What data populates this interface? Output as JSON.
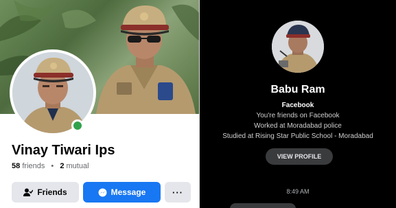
{
  "profile": {
    "name": "Vinay Tiwari Ips",
    "friends_count": "58",
    "friends_label": "friends",
    "separator": "•",
    "mutual_count": "2",
    "mutual_label": "mutual",
    "online_color": "#31a24c"
  },
  "actions": {
    "friends_label": "Friends",
    "message_label": "Message",
    "more_label": "···"
  },
  "messenger": {
    "name": "Babu Ram",
    "app_label": "Facebook",
    "friends_text": "You're friends on Facebook",
    "work_text": "Worked at Moradabad police",
    "study_text": "Studied at Rising Star Public School  - Moradabad",
    "view_profile_label": "VIEW PROFILE",
    "timestamp": "8:49 AM"
  },
  "colors": {
    "brand_blue": "#1877f2",
    "button_grey": "#e4e6eb",
    "dark_bg": "#000000"
  },
  "icons": [
    "person-check-icon",
    "messenger-icon",
    "more-icon"
  ]
}
